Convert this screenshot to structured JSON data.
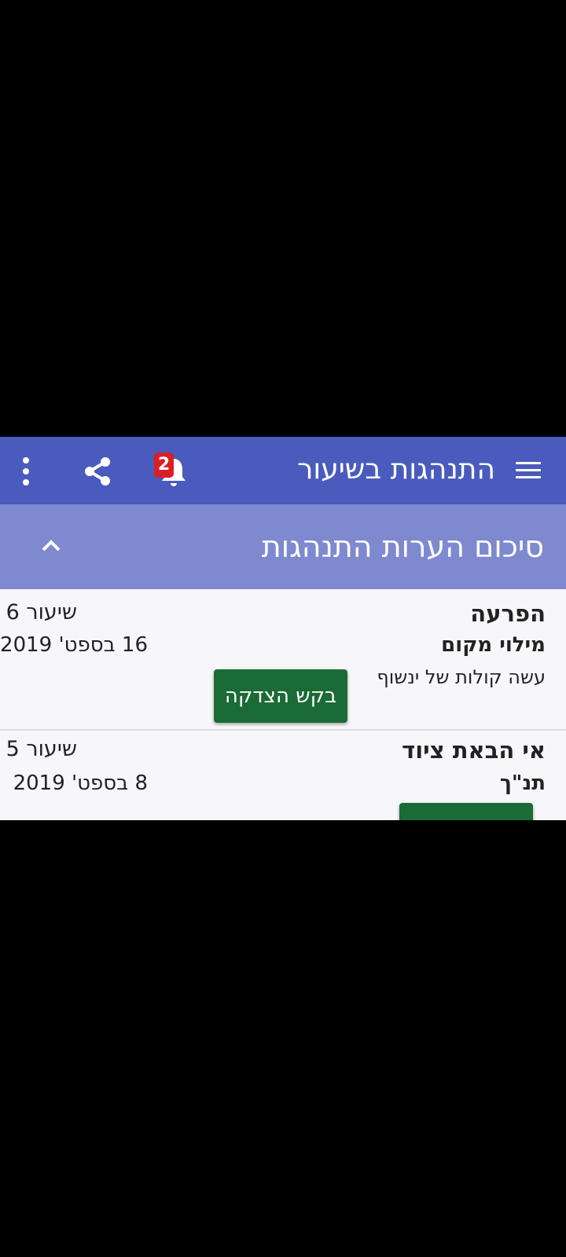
{
  "app_bar": {
    "title": "התנהגות בשיעור",
    "notification_count": "2",
    "icons": [
      "menu-icon",
      "bell-icon",
      "share-icon",
      "more-vert-icon"
    ]
  },
  "section": {
    "title": "סיכום הערות התנהגות",
    "toggle_icon": "chevron-up-icon"
  },
  "records": [
    {
      "type": "הפרעה",
      "subject": "מילוי מקום",
      "description": "עשה קולות של ינשוף",
      "lesson": "שיעור 6",
      "date": "16 בספט' 2019",
      "action_label": "בקש הצדקה"
    },
    {
      "type": "אי הבאת ציוד",
      "subject": "תנ\"ך",
      "lesson": "שיעור 5",
      "date": "8 בספט' 2019"
    }
  ],
  "colors": {
    "app_bar": "#4a5bbd",
    "section_header": "#7e89cf",
    "action_button": "#1b6b36",
    "badge": "#d81f26"
  }
}
